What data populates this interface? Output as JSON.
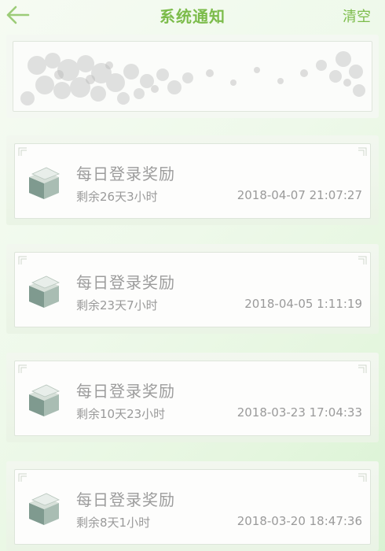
{
  "header": {
    "title": "系统通知",
    "clear_label": "清空",
    "back_icon": "back-arrow-icon"
  },
  "colors": {
    "accent": "#7cbc4b",
    "text_gray": "#9a9a9a"
  },
  "notifications": [
    {
      "title": "每日登录奖励",
      "remaining": "剩余26天3小时",
      "date": "2018-04-07 21:07:27",
      "icon": "gift-box-icon"
    },
    {
      "title": "每日登录奖励",
      "remaining": "剩余23天7小时",
      "date": "2018-04-05 1:11:19",
      "icon": "gift-box-icon"
    },
    {
      "title": "每日登录奖励",
      "remaining": "剩余10天23小时",
      "date": "2018-03-23 17:04:33",
      "icon": "gift-box-icon"
    },
    {
      "title": "每日登录奖励",
      "remaining": "剩余8天1小时",
      "date": "2018-03-20 18:47:36",
      "icon": "gift-box-icon"
    }
  ]
}
